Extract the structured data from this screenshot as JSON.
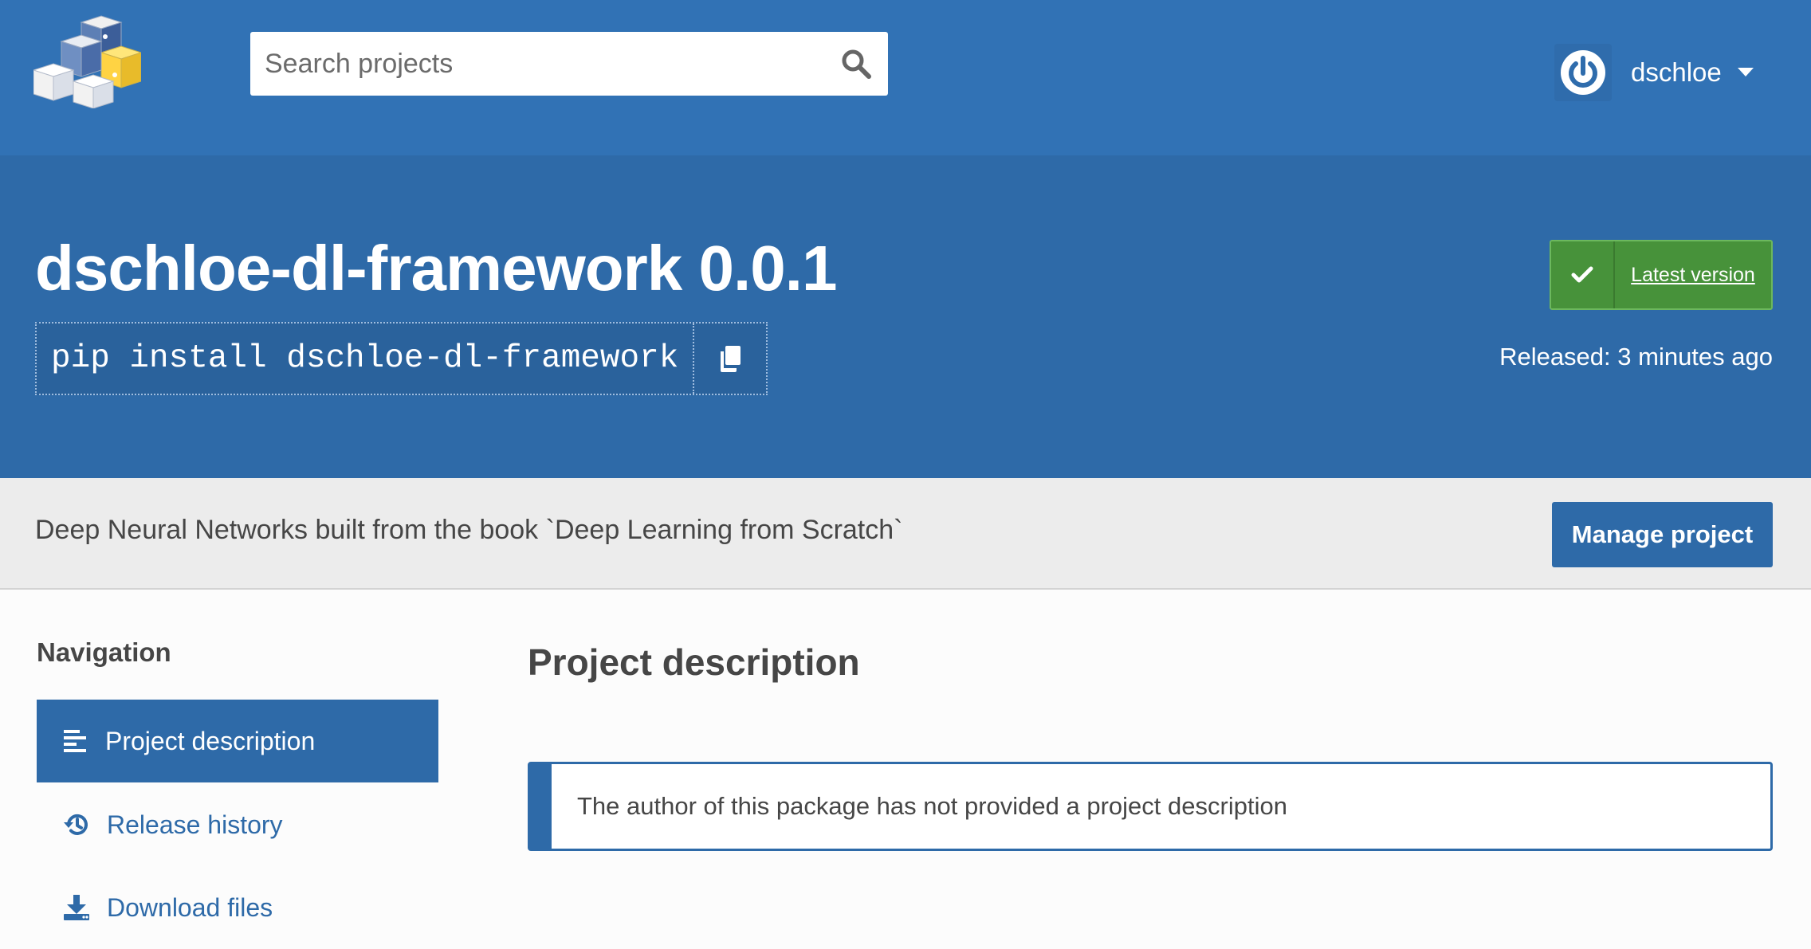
{
  "header": {
    "logo": "pypi-logo-cubes",
    "search": {
      "placeholder": "Search projects",
      "value": "",
      "icon": "search-icon"
    },
    "user": {
      "name": "dschloe",
      "avatar_icon": "power-icon",
      "menu_icon": "caret-down-icon"
    }
  },
  "package": {
    "title": "dschloe-dl-framework 0.0.1",
    "pip_command": "pip install dschloe-dl-framework",
    "copy_icon": "copy-icon",
    "latest_version_label": "Latest version",
    "released": "Released: 3 minutes ago"
  },
  "summary": {
    "text": "Deep Neural Networks built from the book `Deep Learning from Scratch`",
    "manage_button": "Manage project"
  },
  "sidebar": {
    "heading": "Navigation",
    "items": [
      {
        "label": "Project description",
        "icon": "align-left-icon",
        "active": true
      },
      {
        "label": "Release history",
        "icon": "history-icon",
        "active": false
      },
      {
        "label": "Download files",
        "icon": "download-icon",
        "active": false
      }
    ]
  },
  "main": {
    "section_title": "Project description",
    "callout": "The author of this package has not provided a project description"
  },
  "colors": {
    "header_bg": "#3172b5",
    "banner_bg": "#2e6aa8",
    "latest_green": "#47923a",
    "summary_bg": "#ececec",
    "text": "#464646"
  }
}
